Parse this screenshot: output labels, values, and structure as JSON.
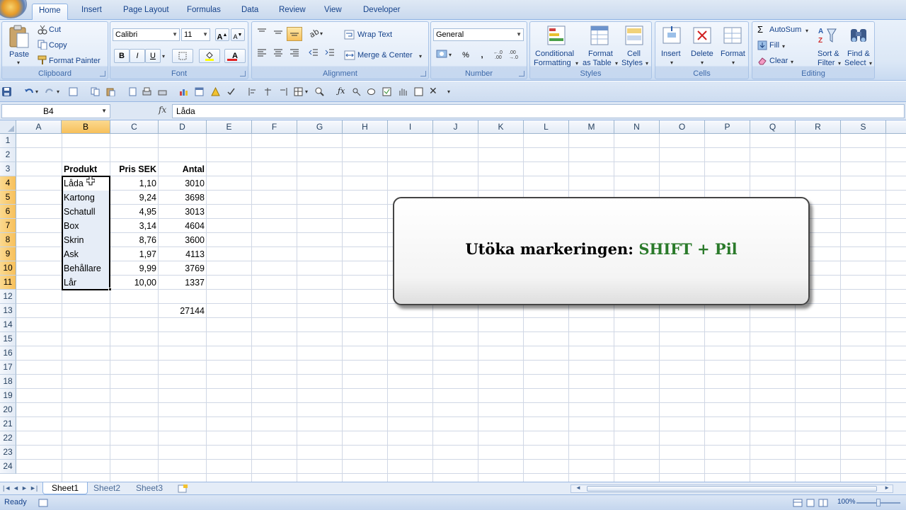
{
  "ribbon_tabs": [
    "Home",
    "Insert",
    "Page Layout",
    "Formulas",
    "Data",
    "Review",
    "View",
    "Developer"
  ],
  "clipboard": {
    "paste": "Paste",
    "cut": "Cut",
    "copy": "Copy",
    "format_painter": "Format Painter",
    "label": "Clipboard"
  },
  "font": {
    "name": "Calibri",
    "size": "11",
    "label": "Font",
    "bold": "B",
    "italic": "I",
    "underline": "U",
    "grow": "A",
    "shrink": "A",
    "color_letter": "A"
  },
  "alignment": {
    "wrap": "Wrap Text",
    "merge": "Merge & Center",
    "label": "Alignment"
  },
  "number": {
    "format": "General",
    "percent": "%",
    "comma": ",",
    "label": "Number"
  },
  "styles": {
    "conditional": "Conditional",
    "conditional2": "Formatting",
    "format_as": "Format",
    "format_as2": "as Table",
    "cell": "Cell",
    "cell2": "Styles",
    "label": "Styles"
  },
  "cells": {
    "insert": "Insert",
    "delete": "Delete",
    "format": "Format",
    "label": "Cells"
  },
  "editing": {
    "sigma": "Σ",
    "autosum": "AutoSum",
    "fill": "Fill",
    "clear": "Clear",
    "sort": "Sort &",
    "sort2": "Filter",
    "find": "Find &",
    "find2": "Select",
    "label": "Editing"
  },
  "formula_bar": {
    "name_box": "B4",
    "fx": "fx",
    "content": "Låda"
  },
  "columns": [
    "A",
    "B",
    "C",
    "D",
    "E",
    "F",
    "G",
    "H",
    "I",
    "J",
    "K",
    "L",
    "M",
    "N",
    "O",
    "P",
    "Q",
    "R",
    "S"
  ],
  "rows": [
    "1",
    "2",
    "3",
    "4",
    "5",
    "6",
    "7",
    "8",
    "9",
    "10",
    "11",
    "12",
    "13",
    "14",
    "15",
    "16",
    "17",
    "18",
    "19",
    "20",
    "21",
    "22",
    "23",
    "24"
  ],
  "table": {
    "headers": [
      "Produkt",
      "Pris SEK",
      "Antal"
    ],
    "rows": [
      [
        "Låda",
        "1,10",
        "3010"
      ],
      [
        "Kartong",
        "9,24",
        "3698"
      ],
      [
        "Schatull",
        "4,95",
        "3013"
      ],
      [
        "Box",
        "3,14",
        "4604"
      ],
      [
        "Skrin",
        "8,76",
        "3600"
      ],
      [
        "Ask",
        "1,97",
        "4113"
      ],
      [
        "Behållare",
        "9,99",
        "3769"
      ],
      [
        "Lår",
        "10,00",
        "1337"
      ]
    ],
    "total": "27144"
  },
  "callout": {
    "text": "Utöka markeringen: ",
    "key": "SHIFT + Pil"
  },
  "sheets": [
    "Sheet1",
    "Sheet2",
    "Sheet3"
  ],
  "status": {
    "text": "Ready",
    "zoom": "100%"
  }
}
